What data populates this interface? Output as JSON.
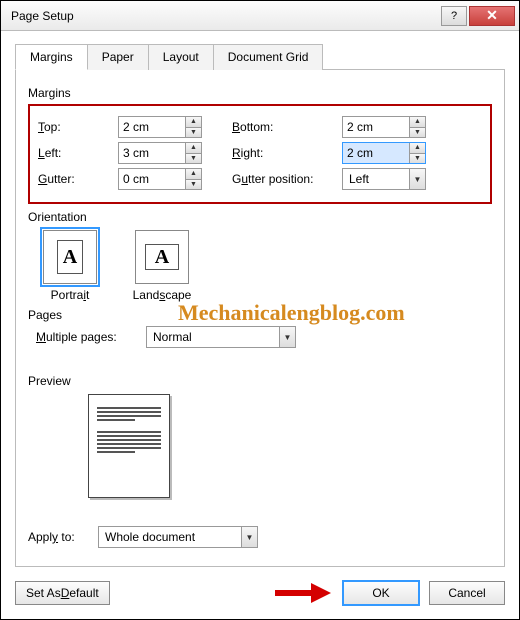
{
  "window": {
    "title": "Page Setup"
  },
  "tabs": {
    "margins": "Margins",
    "paper": "Paper",
    "layout": "Layout",
    "documentGrid": "Document Grid"
  },
  "margins": {
    "groupLabel": "Margins",
    "top": {
      "label": "Top:",
      "accessKey": "T",
      "value": "2 cm"
    },
    "bottom": {
      "label": "Bottom:",
      "accessKey": "B",
      "value": "2 cm"
    },
    "left": {
      "label": "Left:",
      "accessKey": "L",
      "value": "3 cm"
    },
    "right": {
      "label": "Right:",
      "accessKey": "R",
      "value": "2 cm"
    },
    "gutter": {
      "label": "Gutter:",
      "accessKey": "G",
      "value": "0 cm"
    },
    "gutterPos": {
      "label": "Gutter position:",
      "accessKey": "u",
      "value": "Left"
    }
  },
  "orientation": {
    "groupLabel": "Orientation",
    "portrait": "Portrait",
    "landscape": "Landscape"
  },
  "pages": {
    "groupLabel": "Pages",
    "multiple": {
      "label": "Multiple pages:",
      "accessKey": "M",
      "value": "Normal"
    }
  },
  "preview": {
    "groupLabel": "Preview"
  },
  "applyTo": {
    "label": "Apply to:",
    "accessKey": "y",
    "value": "Whole document"
  },
  "buttons": {
    "setDefault": "Set As Default",
    "ok": "OK",
    "cancel": "Cancel"
  },
  "watermark": "Mechanicalengblog.com"
}
